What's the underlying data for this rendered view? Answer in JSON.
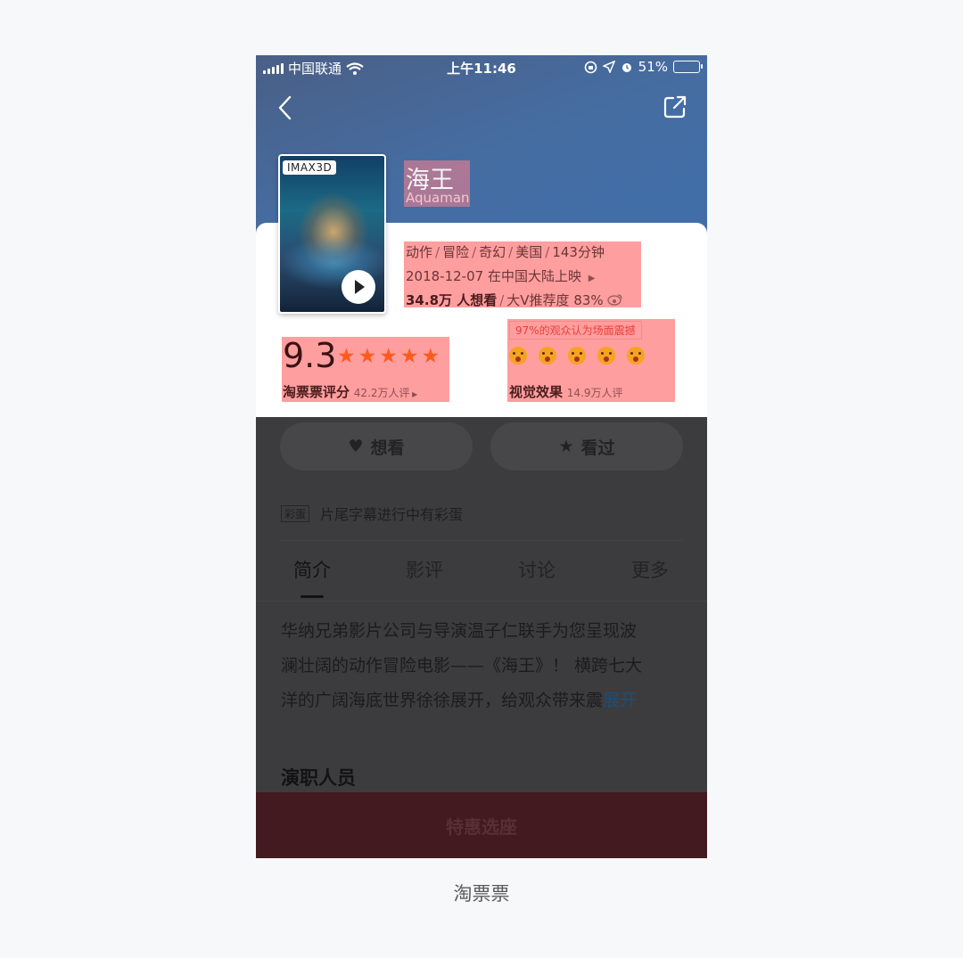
{
  "status_bar": {
    "carrier": "中国联通",
    "time": "上午11:46",
    "battery": "51%",
    "battery_level": 0.51
  },
  "nav": {
    "back_icon": "chevron-left-icon",
    "share_icon": "share-icon"
  },
  "movie": {
    "badge": "IMAX3D",
    "title_cn": "海王",
    "title_en": "Aquaman",
    "genres": [
      "动作",
      "冒险",
      "奇幻",
      "美国",
      "143分钟"
    ],
    "release": "2018-12-07 在中国大陆上映",
    "want_count": "34.8万 人想看",
    "recommend": "大V推荐度 83%"
  },
  "rating": {
    "score": "9.3",
    "stars": 5,
    "label": "淘票票评分",
    "count": "42.2万人评",
    "star_color": "#ff5a1e"
  },
  "visual": {
    "tag": "97%的观众认为场面震撼",
    "label": "视觉效果",
    "count": "14.9万人评",
    "emoji_count": 5
  },
  "actions": {
    "want": "想看",
    "seen": "看过"
  },
  "egg": {
    "tag": "彩蛋",
    "text": "片尾字幕进行中有彩蛋"
  },
  "tabs": [
    "简介",
    "影评",
    "讨论",
    "更多"
  ],
  "active_tab": "简介",
  "synopsis": {
    "line1": "华纳兄弟影片公司与导演温子仁联手为您呈现波",
    "line2": "澜壮阔的动作冒险电影——《海王》！ 横跨七大",
    "line3": "洋的广阔海底世界徐徐展开，给观众带来震",
    "expand": "展开"
  },
  "cast_title": "演职人员",
  "bottom_button": "特惠选座",
  "caption": "淘票票"
}
